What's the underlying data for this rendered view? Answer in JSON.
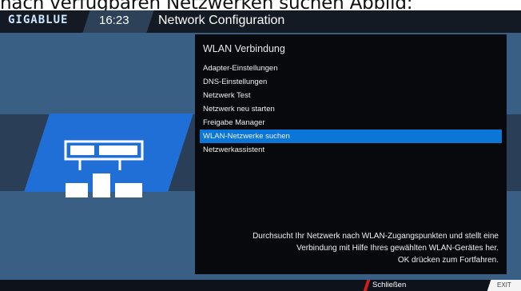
{
  "caption": "nach verfügbaren Netzwerken suchen Abbild:",
  "header": {
    "logo": "GIGABLUE",
    "time": "16:23",
    "title": "Network Configuration"
  },
  "panel": {
    "title": "WLAN Verbindung",
    "menu_items": [
      {
        "label": "Adapter-Einstellungen"
      },
      {
        "label": "DNS-Einstellungen"
      },
      {
        "label": "Netzwerk Test"
      },
      {
        "label": "Netzwerk neu starten"
      },
      {
        "label": "Freigabe Manager"
      },
      {
        "label": "WLAN-Netzwerke suchen",
        "selected": true
      },
      {
        "label": "Netzwerkassistent"
      }
    ],
    "description": [
      "Durchsucht Ihr Netzwerk nach WLAN-Zugangspunkten und stellt eine",
      "Verbindung mit Hilfe Ihres gewählten WLAN-Gerätes her.",
      "OK drücken zum Fortfahren."
    ]
  },
  "footer": {
    "close_label": "Schließen",
    "exit_label": "EXIT"
  },
  "icons": {
    "illustration": "network-device-icon"
  },
  "colors": {
    "background": "#3a5f84",
    "accent": "#0a76d8",
    "panel": "#07090d",
    "red_key": "#d21d1d"
  }
}
